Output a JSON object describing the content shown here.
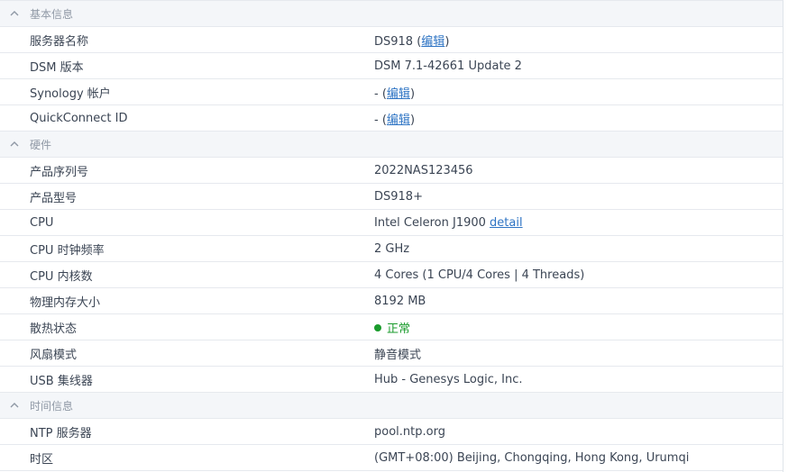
{
  "sections": {
    "basic": {
      "title": "基本信息",
      "server_name": {
        "label": "服务器名称",
        "value": "DS918",
        "edit_link": "编辑"
      },
      "dsm_version": {
        "label": "DSM 版本",
        "value": "DSM 7.1-42661 Update 2"
      },
      "synology_account": {
        "label": "Synology 帐户",
        "value": "-",
        "edit_link": "编辑"
      },
      "quickconnect": {
        "label": "QuickConnect ID",
        "value": "-",
        "edit_link": "编辑"
      }
    },
    "hardware": {
      "title": "硬件",
      "serial": {
        "label": "产品序列号",
        "value": "2022NAS123456"
      },
      "model": {
        "label": "产品型号",
        "value": "DS918+"
      },
      "cpu": {
        "label": "CPU",
        "value": "Intel Celeron J1900",
        "detail_link": "detail"
      },
      "cpu_clock": {
        "label": "CPU 时钟频率",
        "value": "2 GHz"
      },
      "cpu_cores": {
        "label": "CPU 内核数",
        "value": "4 Cores (1 CPU/4 Cores | 4 Threads)"
      },
      "memory": {
        "label": "物理内存大小",
        "value": "8192 MB"
      },
      "thermal": {
        "label": "散热状态",
        "value": "正常",
        "status_color": "#1a9b2c"
      },
      "fan": {
        "label": "风扇模式",
        "value": "静音模式"
      },
      "usb_hub": {
        "label": "USB 集线器",
        "value": "Hub - Genesys Logic, Inc."
      }
    },
    "time": {
      "title": "时间信息",
      "ntp": {
        "label": "NTP 服务器",
        "value": "pool.ntp.org"
      },
      "timezone": {
        "label": "时区",
        "value": "(GMT+08:00) Beijing, Chongqing, Hong Kong, Urumqi"
      }
    }
  },
  "icons": {
    "section_toggle": "chevron-up-icon",
    "status": "status-dot-icon"
  },
  "colors": {
    "link": "#2e74c4",
    "ok": "#1a9b2c",
    "header_bg": "#f4f6f9"
  }
}
